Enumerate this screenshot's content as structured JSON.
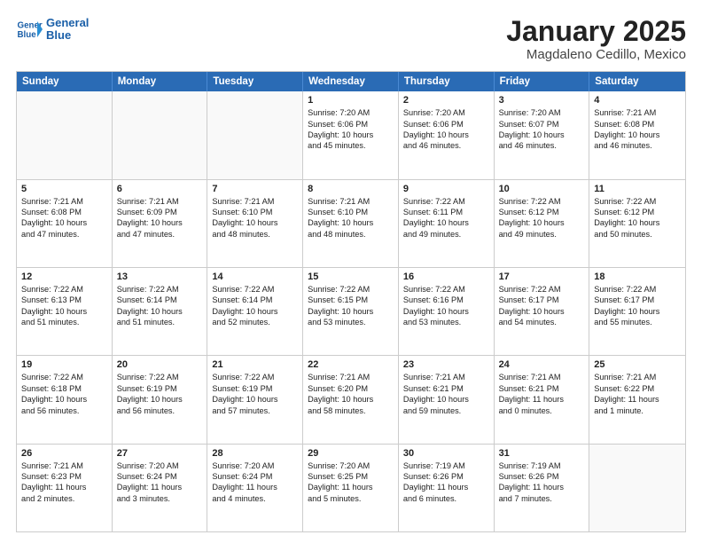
{
  "logo": {
    "line1": "General",
    "line2": "Blue"
  },
  "title": "January 2025",
  "subtitle": "Magdaleno Cedillo, Mexico",
  "days_of_week": [
    "Sunday",
    "Monday",
    "Tuesday",
    "Wednesday",
    "Thursday",
    "Friday",
    "Saturday"
  ],
  "weeks": [
    [
      {
        "day": "",
        "lines": []
      },
      {
        "day": "",
        "lines": []
      },
      {
        "day": "",
        "lines": []
      },
      {
        "day": "1",
        "lines": [
          "Sunrise: 7:20 AM",
          "Sunset: 6:06 PM",
          "Daylight: 10 hours",
          "and 45 minutes."
        ]
      },
      {
        "day": "2",
        "lines": [
          "Sunrise: 7:20 AM",
          "Sunset: 6:06 PM",
          "Daylight: 10 hours",
          "and 46 minutes."
        ]
      },
      {
        "day": "3",
        "lines": [
          "Sunrise: 7:20 AM",
          "Sunset: 6:07 PM",
          "Daylight: 10 hours",
          "and 46 minutes."
        ]
      },
      {
        "day": "4",
        "lines": [
          "Sunrise: 7:21 AM",
          "Sunset: 6:08 PM",
          "Daylight: 10 hours",
          "and 46 minutes."
        ]
      }
    ],
    [
      {
        "day": "5",
        "lines": [
          "Sunrise: 7:21 AM",
          "Sunset: 6:08 PM",
          "Daylight: 10 hours",
          "and 47 minutes."
        ]
      },
      {
        "day": "6",
        "lines": [
          "Sunrise: 7:21 AM",
          "Sunset: 6:09 PM",
          "Daylight: 10 hours",
          "and 47 minutes."
        ]
      },
      {
        "day": "7",
        "lines": [
          "Sunrise: 7:21 AM",
          "Sunset: 6:10 PM",
          "Daylight: 10 hours",
          "and 48 minutes."
        ]
      },
      {
        "day": "8",
        "lines": [
          "Sunrise: 7:21 AM",
          "Sunset: 6:10 PM",
          "Daylight: 10 hours",
          "and 48 minutes."
        ]
      },
      {
        "day": "9",
        "lines": [
          "Sunrise: 7:22 AM",
          "Sunset: 6:11 PM",
          "Daylight: 10 hours",
          "and 49 minutes."
        ]
      },
      {
        "day": "10",
        "lines": [
          "Sunrise: 7:22 AM",
          "Sunset: 6:12 PM",
          "Daylight: 10 hours",
          "and 49 minutes."
        ]
      },
      {
        "day": "11",
        "lines": [
          "Sunrise: 7:22 AM",
          "Sunset: 6:12 PM",
          "Daylight: 10 hours",
          "and 50 minutes."
        ]
      }
    ],
    [
      {
        "day": "12",
        "lines": [
          "Sunrise: 7:22 AM",
          "Sunset: 6:13 PM",
          "Daylight: 10 hours",
          "and 51 minutes."
        ]
      },
      {
        "day": "13",
        "lines": [
          "Sunrise: 7:22 AM",
          "Sunset: 6:14 PM",
          "Daylight: 10 hours",
          "and 51 minutes."
        ]
      },
      {
        "day": "14",
        "lines": [
          "Sunrise: 7:22 AM",
          "Sunset: 6:14 PM",
          "Daylight: 10 hours",
          "and 52 minutes."
        ]
      },
      {
        "day": "15",
        "lines": [
          "Sunrise: 7:22 AM",
          "Sunset: 6:15 PM",
          "Daylight: 10 hours",
          "and 53 minutes."
        ]
      },
      {
        "day": "16",
        "lines": [
          "Sunrise: 7:22 AM",
          "Sunset: 6:16 PM",
          "Daylight: 10 hours",
          "and 53 minutes."
        ]
      },
      {
        "day": "17",
        "lines": [
          "Sunrise: 7:22 AM",
          "Sunset: 6:17 PM",
          "Daylight: 10 hours",
          "and 54 minutes."
        ]
      },
      {
        "day": "18",
        "lines": [
          "Sunrise: 7:22 AM",
          "Sunset: 6:17 PM",
          "Daylight: 10 hours",
          "and 55 minutes."
        ]
      }
    ],
    [
      {
        "day": "19",
        "lines": [
          "Sunrise: 7:22 AM",
          "Sunset: 6:18 PM",
          "Daylight: 10 hours",
          "and 56 minutes."
        ]
      },
      {
        "day": "20",
        "lines": [
          "Sunrise: 7:22 AM",
          "Sunset: 6:19 PM",
          "Daylight: 10 hours",
          "and 56 minutes."
        ]
      },
      {
        "day": "21",
        "lines": [
          "Sunrise: 7:22 AM",
          "Sunset: 6:19 PM",
          "Daylight: 10 hours",
          "and 57 minutes."
        ]
      },
      {
        "day": "22",
        "lines": [
          "Sunrise: 7:21 AM",
          "Sunset: 6:20 PM",
          "Daylight: 10 hours",
          "and 58 minutes."
        ]
      },
      {
        "day": "23",
        "lines": [
          "Sunrise: 7:21 AM",
          "Sunset: 6:21 PM",
          "Daylight: 10 hours",
          "and 59 minutes."
        ]
      },
      {
        "day": "24",
        "lines": [
          "Sunrise: 7:21 AM",
          "Sunset: 6:21 PM",
          "Daylight: 11 hours",
          "and 0 minutes."
        ]
      },
      {
        "day": "25",
        "lines": [
          "Sunrise: 7:21 AM",
          "Sunset: 6:22 PM",
          "Daylight: 11 hours",
          "and 1 minute."
        ]
      }
    ],
    [
      {
        "day": "26",
        "lines": [
          "Sunrise: 7:21 AM",
          "Sunset: 6:23 PM",
          "Daylight: 11 hours",
          "and 2 minutes."
        ]
      },
      {
        "day": "27",
        "lines": [
          "Sunrise: 7:20 AM",
          "Sunset: 6:24 PM",
          "Daylight: 11 hours",
          "and 3 minutes."
        ]
      },
      {
        "day": "28",
        "lines": [
          "Sunrise: 7:20 AM",
          "Sunset: 6:24 PM",
          "Daylight: 11 hours",
          "and 4 minutes."
        ]
      },
      {
        "day": "29",
        "lines": [
          "Sunrise: 7:20 AM",
          "Sunset: 6:25 PM",
          "Daylight: 11 hours",
          "and 5 minutes."
        ]
      },
      {
        "day": "30",
        "lines": [
          "Sunrise: 7:19 AM",
          "Sunset: 6:26 PM",
          "Daylight: 11 hours",
          "and 6 minutes."
        ]
      },
      {
        "day": "31",
        "lines": [
          "Sunrise: 7:19 AM",
          "Sunset: 6:26 PM",
          "Daylight: 11 hours",
          "and 7 minutes."
        ]
      },
      {
        "day": "",
        "lines": []
      }
    ]
  ]
}
